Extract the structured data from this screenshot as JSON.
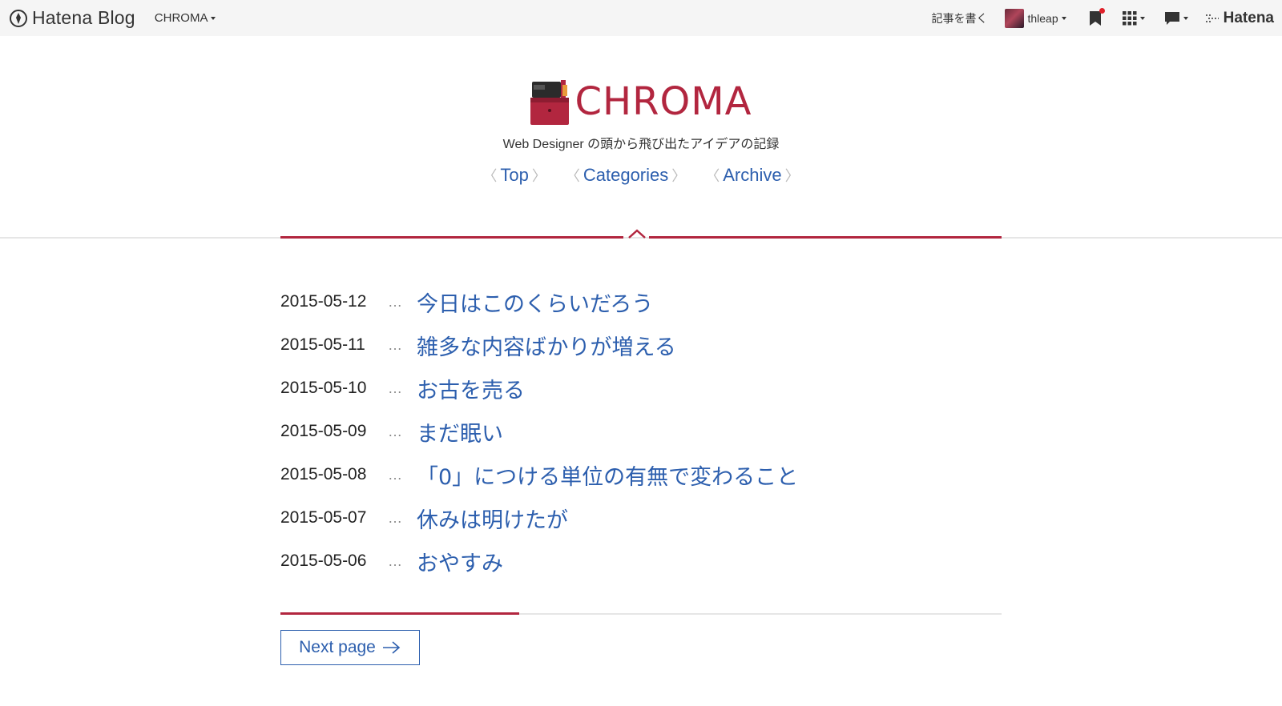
{
  "globalbar": {
    "brand": "Hatena Blog",
    "blog_selector": "CHROMA",
    "write_label": "記事を書く",
    "username": "thleap",
    "hatena_label": "Hatena"
  },
  "blog": {
    "title": "CHROMA",
    "description": "Web Designer の頭から飛び出たアイデアの記録",
    "nav": [
      {
        "label": "Top"
      },
      {
        "label": "Categories"
      },
      {
        "label": "Archive"
      }
    ]
  },
  "entries": [
    {
      "date": "2015-05-12",
      "sep": "…",
      "title": "今日はこのくらいだろう"
    },
    {
      "date": "2015-05-11",
      "sep": "…",
      "title": "雑多な内容ばかりが増える"
    },
    {
      "date": "2015-05-10",
      "sep": "…",
      "title": "お古を売る"
    },
    {
      "date": "2015-05-09",
      "sep": "…",
      "title": "まだ眠い"
    },
    {
      "date": "2015-05-08",
      "sep": "…",
      "title": "「0」につける単位の有無で変わること"
    },
    {
      "date": "2015-05-07",
      "sep": "…",
      "title": "休みは明けたが"
    },
    {
      "date": "2015-05-06",
      "sep": "…",
      "title": "おやすみ"
    }
  ],
  "pager": {
    "next_label": "Next page"
  },
  "colors": {
    "accent": "#b2263f",
    "link": "#2d5fae"
  },
  "icons": {
    "logo": "hatena-pen-icon",
    "star": "bookmark-icon",
    "apps": "grid-icon",
    "notify": "comment-icon",
    "next": "arrow-right-icon"
  }
}
